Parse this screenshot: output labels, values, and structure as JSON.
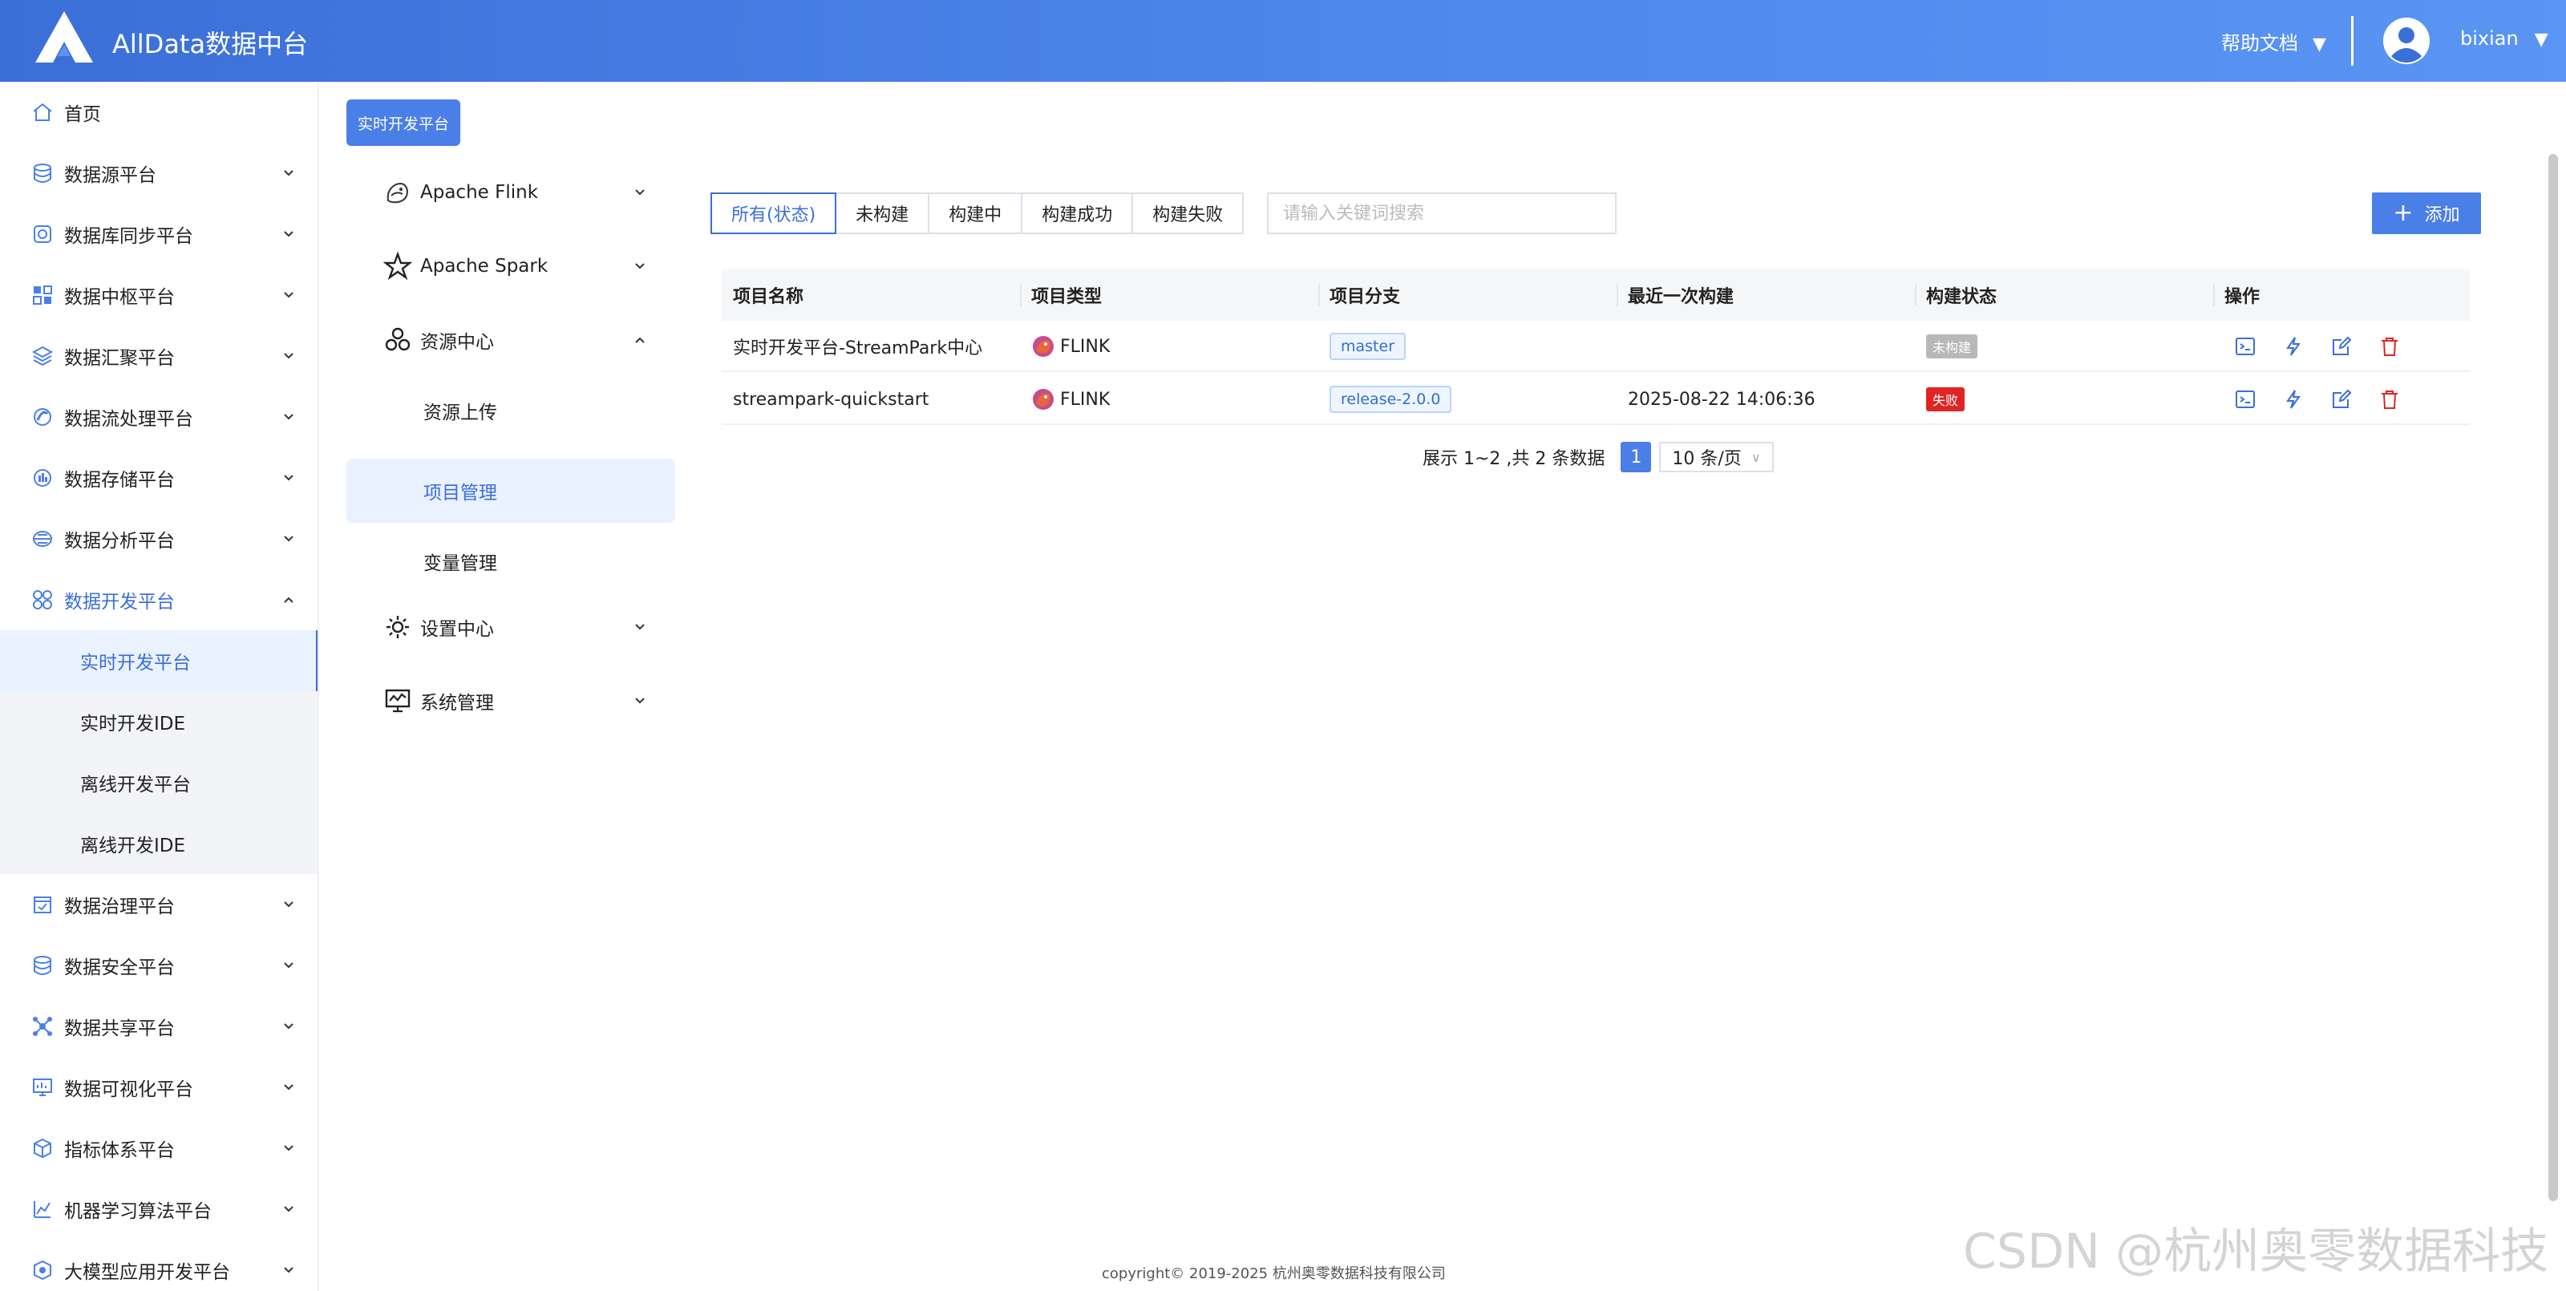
{
  "header": {
    "app_title": "AllData数据中台",
    "help_label": "帮助文档",
    "caret": "▼",
    "username": "bixian"
  },
  "sidebar": {
    "items": [
      {
        "label": "首页",
        "icon": "home-icon",
        "has_chevron": false
      },
      {
        "label": "数据源平台",
        "icon": "database-icon",
        "has_chevron": true
      },
      {
        "label": "数据库同步平台",
        "icon": "sync-icon",
        "has_chevron": true
      },
      {
        "label": "数据中枢平台",
        "icon": "grid-icon",
        "has_chevron": true
      },
      {
        "label": "数据汇聚平台",
        "icon": "layers-icon",
        "has_chevron": true
      },
      {
        "label": "数据流处理平台",
        "icon": "stream-icon",
        "has_chevron": true
      },
      {
        "label": "数据存储平台",
        "icon": "storage-icon",
        "has_chevron": true
      },
      {
        "label": "数据分析平台",
        "icon": "analysis-icon",
        "has_chevron": true
      },
      {
        "label": "数据开发平台",
        "icon": "dev-icon",
        "has_chevron": true,
        "expanded": true,
        "active": true
      },
      {
        "label": "数据治理平台",
        "icon": "governance-icon",
        "has_chevron": true
      },
      {
        "label": "数据安全平台",
        "icon": "security-icon",
        "has_chevron": true
      },
      {
        "label": "数据共享平台",
        "icon": "share-icon",
        "has_chevron": true
      },
      {
        "label": "数据可视化平台",
        "icon": "visual-icon",
        "has_chevron": true
      },
      {
        "label": "指标体系平台",
        "icon": "cube-icon",
        "has_chevron": true
      },
      {
        "label": "机器学习算法平台",
        "icon": "ml-icon",
        "has_chevron": true
      },
      {
        "label": "大模型应用开发平台",
        "icon": "llm-icon",
        "has_chevron": true
      }
    ],
    "sub_items": [
      {
        "label": "实时开发平台",
        "selected": true
      },
      {
        "label": "实时开发IDE",
        "selected": false
      },
      {
        "label": "离线开发平台",
        "selected": false
      },
      {
        "label": "离线开发IDE",
        "selected": false
      }
    ]
  },
  "breadcrumb": "实时开发平台",
  "second_menu": {
    "items": [
      {
        "label": "Apache Flink",
        "icon": "flink-icon",
        "chev": "down"
      },
      {
        "label": "Apache Spark",
        "icon": "spark-icon",
        "chev": "down"
      },
      {
        "label": "资源中心",
        "icon": "resource-icon",
        "chev": "up"
      },
      {
        "label": "设置中心",
        "icon": "settings-icon",
        "chev": "down"
      },
      {
        "label": "系统管理",
        "icon": "monitor-icon",
        "chev": "down"
      }
    ],
    "sub_items": [
      {
        "label": "资源上传",
        "selected": false
      },
      {
        "label": "项目管理",
        "selected": true
      },
      {
        "label": "变量管理",
        "selected": false
      }
    ]
  },
  "filters": {
    "tabs": [
      "所有(状态)",
      "未构建",
      "构建中",
      "构建成功",
      "构建失败"
    ],
    "active_index": 0,
    "search_placeholder": "请输入关键词搜索",
    "add_label": "添加"
  },
  "table": {
    "columns": [
      "项目名称",
      "项目类型",
      "项目分支",
      "最近一次构建",
      "构建状态",
      "操作"
    ],
    "rows": [
      {
        "name": "实时开发平台-StreamPark中心",
        "type": "FLINK",
        "branch": "master",
        "last_build": "",
        "status": "未构建",
        "status_color": "#b8b8b8"
      },
      {
        "name": "streampark-quickstart",
        "type": "FLINK",
        "branch": "release-2.0.0",
        "last_build": "2025-08-22 14:06:36",
        "status": "失败",
        "status_color": "#e02424"
      }
    ],
    "actions": [
      "terminal-icon",
      "build-icon",
      "edit-icon",
      "delete-icon"
    ]
  },
  "pagination": {
    "summary": "展示 1~2 ,共 2 条数据",
    "current_page": "1",
    "page_size": "10 条/页"
  },
  "footer": {
    "copyright": "copyright© 2019-2025 杭州奥零数据科技有限公司",
    "watermark": "CSDN @杭州奥零数据科技"
  },
  "colors": {
    "primary": "#4a7fe8",
    "header_gradient_start": "#3b6fd8",
    "header_gradient_end": "#5a95f3",
    "danger": "#e02424"
  }
}
